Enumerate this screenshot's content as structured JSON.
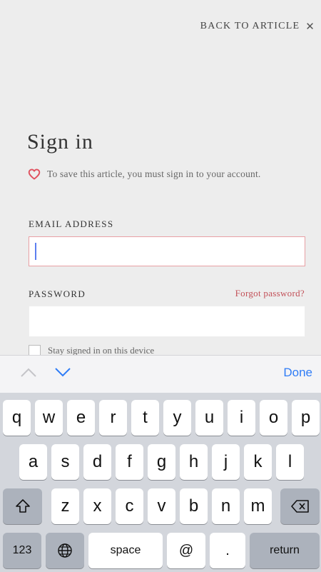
{
  "top_bar": {
    "back_label": "BACK TO ARTICLE",
    "close_glyph": "✕"
  },
  "page": {
    "title": "Sign in",
    "notice": "To save this article, you must sign in to your account.",
    "heart_icon": "heart-outline",
    "accent_color": "#e0505e"
  },
  "form": {
    "email_label": "EMAIL ADDRESS",
    "email_value": "",
    "password_label": "PASSWORD",
    "password_value": "",
    "forgot_label": "Forgot password?",
    "stay_signed_in_label": "Stay signed in on this device",
    "stay_signed_in_checked": false
  },
  "accessory": {
    "done_label": "Done"
  },
  "keyboard": {
    "row1": [
      "q",
      "w",
      "e",
      "r",
      "t",
      "y",
      "u",
      "i",
      "o",
      "p"
    ],
    "row2": [
      "a",
      "s",
      "d",
      "f",
      "g",
      "h",
      "j",
      "k",
      "l"
    ],
    "row3": [
      "z",
      "x",
      "c",
      "v",
      "b",
      "n",
      "m"
    ],
    "numbers_label": "123",
    "space_label": "space",
    "at_label": "@",
    "dot_label": ".",
    "return_label": "return"
  }
}
